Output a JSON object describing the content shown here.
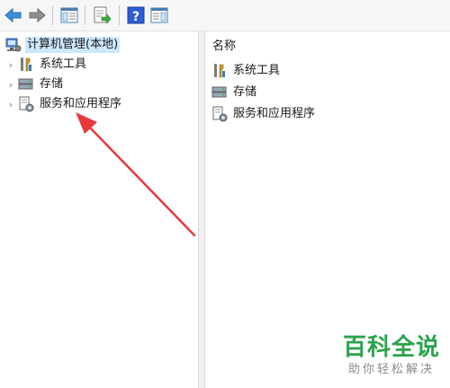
{
  "toolbar": {
    "buttons": [
      {
        "icon": "back-arrow-icon"
      },
      {
        "icon": "forward-arrow-icon"
      },
      {
        "icon": "show-hide-console-tree-icon"
      },
      {
        "icon": "export-list-icon"
      },
      {
        "icon": "help-icon"
      },
      {
        "icon": "show-hide-action-pane-icon"
      }
    ]
  },
  "tree": {
    "root": {
      "label": "计算机管理(本地)",
      "icon": "computer-management-icon"
    },
    "items": [
      {
        "label": "系统工具",
        "icon": "system-tools-icon"
      },
      {
        "label": "存储",
        "icon": "storage-icon"
      },
      {
        "label": "服务和应用程序",
        "icon": "services-applications-icon"
      }
    ]
  },
  "list": {
    "column_header": "名称",
    "items": [
      {
        "label": "系统工具",
        "icon": "system-tools-icon"
      },
      {
        "label": "存储",
        "icon": "storage-icon"
      },
      {
        "label": "服务和应用程序",
        "icon": "services-applications-icon"
      }
    ]
  },
  "annotation": {
    "color": "#e63a3a",
    "points_to": "服务和应用程序"
  },
  "watermark": {
    "title": "百科全说",
    "subtitle": "助你轻松解决",
    "color": "#2aa34a"
  }
}
